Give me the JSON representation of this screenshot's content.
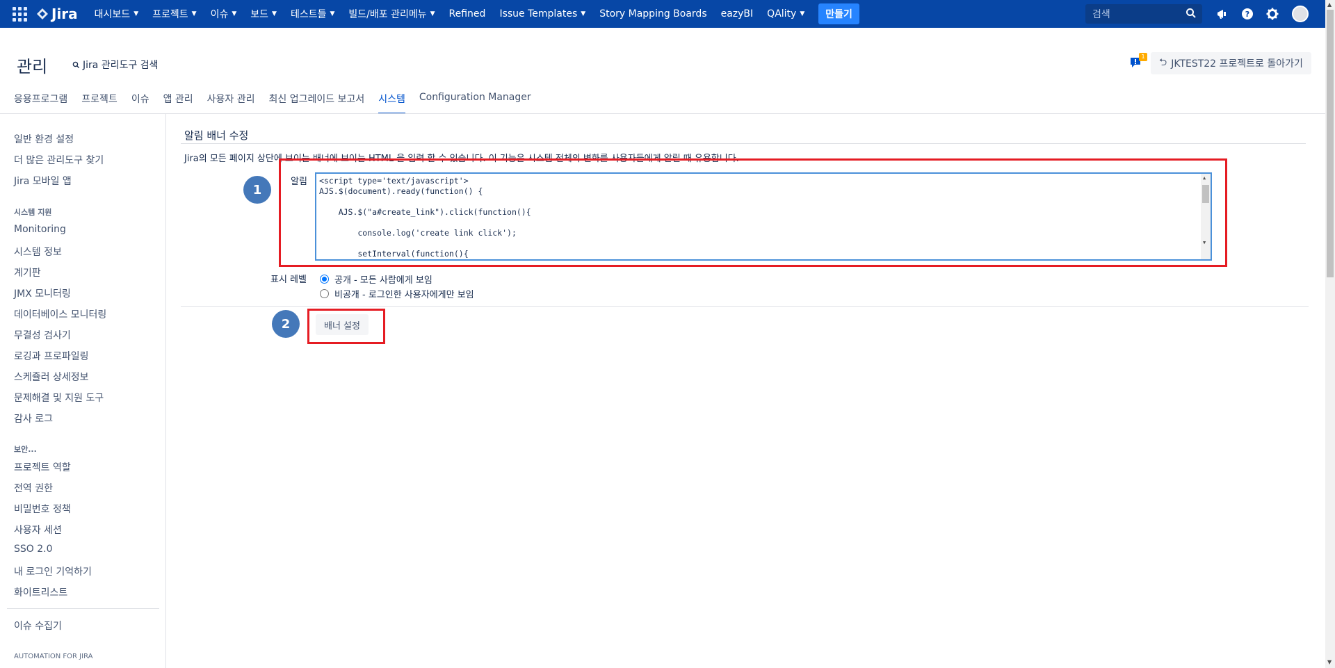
{
  "topnav": {
    "logo_text": "Jira",
    "items": [
      {
        "label": "대시보드",
        "has_menu": true
      },
      {
        "label": "프로젝트",
        "has_menu": true
      },
      {
        "label": "이슈",
        "has_menu": true
      },
      {
        "label": "보드",
        "has_menu": true
      },
      {
        "label": "테스트들",
        "has_menu": true
      },
      {
        "label": "빌드/배포 관리메뉴",
        "has_menu": true
      },
      {
        "label": "Refined",
        "has_menu": false
      },
      {
        "label": "Issue Templates",
        "has_menu": true
      },
      {
        "label": "Story Mapping Boards",
        "has_menu": false
      },
      {
        "label": "eazyBI",
        "has_menu": false
      },
      {
        "label": "QAlity",
        "has_menu": true
      }
    ],
    "create_label": "만들기",
    "search_placeholder": "검색",
    "colors": {
      "bar": "#0747a6",
      "create": "#2684ff"
    }
  },
  "admin": {
    "title": "관리",
    "search_label": "Jira 관리도구 검색",
    "notification_count": "1",
    "back_label": "JKTEST22 프로젝트로 돌아가기"
  },
  "tabs": [
    {
      "label": "응용프로그램",
      "active": false
    },
    {
      "label": "프로젝트",
      "active": false
    },
    {
      "label": "이슈",
      "active": false
    },
    {
      "label": "앱 관리",
      "active": false
    },
    {
      "label": "사용자 관리",
      "active": false
    },
    {
      "label": "최신 업그레이드 보고서",
      "active": false
    },
    {
      "label": "시스템",
      "active": true
    },
    {
      "label": "Configuration Manager",
      "active": false
    }
  ],
  "sidebar": {
    "top_items": [
      "일반 환경 설정",
      "더 많은 관리도구 찾기",
      "Jira 모바일 앱"
    ],
    "system_support_heading": "시스템 지원",
    "system_support_items": [
      "Monitoring",
      "시스템 정보",
      "계기판",
      "JMX 모니터링",
      "데이터베이스 모니터링",
      "무결성 검사기",
      "로깅과 프로파일링",
      "스케쥴러 상세정보",
      "문제해결 및 지원 도구",
      "감사 로그"
    ],
    "security_heading": "보안...",
    "security_items": [
      "프로젝트 역할",
      "전역 권한",
      "비밀번호 정책",
      "사용자 세션",
      "SSO 2.0",
      "내 로그인 기억하기",
      "화이트리스트"
    ],
    "issue_collector": "이슈 수집기",
    "automation_heading": "AUTOMATION FOR JIRA"
  },
  "main": {
    "section_title": "알림 배너 수정",
    "description": "Jira의 모든 페이지 상단에 보이는 배너에 보이는 HTML 을 입력 할 수 있습니다. 이 기능은 시스템 전체의 변화를 사용자들에게 알릴 때 유용합니다.",
    "announcement_label": "알림",
    "code_lines": [
      "<script type='text/javascript'>",
      "AJS.$(document).ready(function() {",
      "",
      "    AJS.$(\"a#create_link\").click(function(){",
      "",
      "        console.log('create link click');",
      "",
      "        setInterval(function(){"
    ],
    "visibility_label": "표시 레벨",
    "visibility_options": [
      {
        "label": "공개 - 모든 사람에게 보임",
        "checked": true
      },
      {
        "label": "비공개 - 로그인한 사용자에게만 보임",
        "checked": false
      }
    ],
    "submit_label": "배너 설정",
    "annotations": {
      "step1": "1",
      "step2": "2",
      "highlight_color": "#e51c23",
      "circle_color": "#4478b9"
    }
  }
}
